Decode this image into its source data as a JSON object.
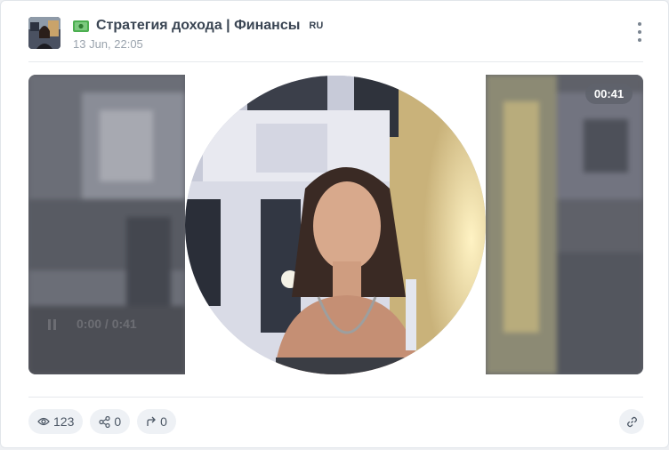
{
  "post": {
    "channel_title": "Стратегия дохода | Финансы",
    "language_badge": "RU",
    "date": "13 Jun, 22:05",
    "title_icon": "money-banknote-icon",
    "menu_icon": "more-vertical-icon"
  },
  "video": {
    "duration": "00:41",
    "ghost_player_time": "0:00 / 0:41"
  },
  "stats": {
    "views": "123",
    "shares": "0",
    "forwards": "0",
    "views_icon": "eye-icon",
    "shares_icon": "share-icon",
    "forwards_icon": "forward-icon",
    "link_icon": "link-icon"
  },
  "colors": {
    "title": "#3a4553",
    "muted": "#9aa3ad",
    "pill_bg": "#eef1f5"
  }
}
